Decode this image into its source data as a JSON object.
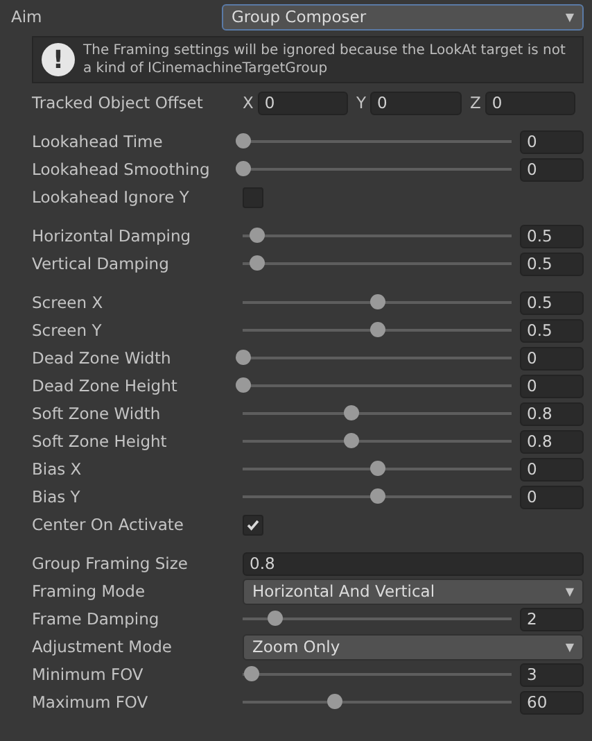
{
  "aim": {
    "label": "Aim",
    "value": "Group Composer",
    "arrow": "▼"
  },
  "warning": {
    "icon": "!",
    "text": "The Framing settings will be ignored because the LookAt target is not a kind of ICinemachineTargetGroup"
  },
  "sections": [
    {
      "rows": [
        {
          "kind": "vector",
          "label": "Tracked Object Offset",
          "components": [
            {
              "axis": "X",
              "value": "0"
            },
            {
              "axis": "Y",
              "value": "0"
            },
            {
              "axis": "Z",
              "value": "0"
            }
          ]
        }
      ]
    },
    {
      "rows": [
        {
          "kind": "slider",
          "label": "Lookahead Time",
          "level": 0,
          "value": "0"
        },
        {
          "kind": "slider",
          "label": "Lookahead Smoothing",
          "level": 0,
          "value": "0"
        },
        {
          "kind": "checkbox",
          "label": "Lookahead Ignore Y",
          "checked": false
        }
      ]
    },
    {
      "rows": [
        {
          "kind": "slider",
          "label": "Horizontal Damping",
          "level": 0.05,
          "value": "0.5"
        },
        {
          "kind": "slider",
          "label": "Vertical Damping",
          "level": 0.05,
          "value": "0.5"
        }
      ]
    },
    {
      "rows": [
        {
          "kind": "slider",
          "label": "Screen X",
          "level": 0.5,
          "value": "0.5"
        },
        {
          "kind": "slider",
          "label": "Screen Y",
          "level": 0.5,
          "value": "0.5"
        },
        {
          "kind": "slider",
          "label": "Dead Zone Width",
          "level": 0,
          "value": "0"
        },
        {
          "kind": "slider",
          "label": "Dead Zone Height",
          "level": 0,
          "value": "0"
        },
        {
          "kind": "slider",
          "label": "Soft Zone Width",
          "level": 0.4,
          "value": "0.8"
        },
        {
          "kind": "slider",
          "label": "Soft Zone Height",
          "level": 0.4,
          "value": "0.8"
        },
        {
          "kind": "slider",
          "label": "Bias X",
          "level": 0.5,
          "value": "0"
        },
        {
          "kind": "slider",
          "label": "Bias Y",
          "level": 0.5,
          "value": "0"
        },
        {
          "kind": "checkbox",
          "label": "Center On Activate",
          "checked": true
        }
      ]
    },
    {
      "rows": [
        {
          "kind": "text",
          "label": "Group Framing Size",
          "value": "0.8"
        },
        {
          "kind": "dropdown",
          "label": "Framing Mode",
          "value": "Horizontal And Vertical",
          "arrow": "▼"
        },
        {
          "kind": "slider",
          "label": "Frame Damping",
          "level": 0.12,
          "value": "2"
        },
        {
          "kind": "dropdown",
          "label": "Adjustment Mode",
          "value": "Zoom Only",
          "arrow": "▼"
        },
        {
          "kind": "slider",
          "label": "Minimum FOV",
          "level": 0.03,
          "value": "3"
        },
        {
          "kind": "slider",
          "label": "Maximum FOV",
          "level": 0.34,
          "value": "60"
        }
      ]
    }
  ]
}
